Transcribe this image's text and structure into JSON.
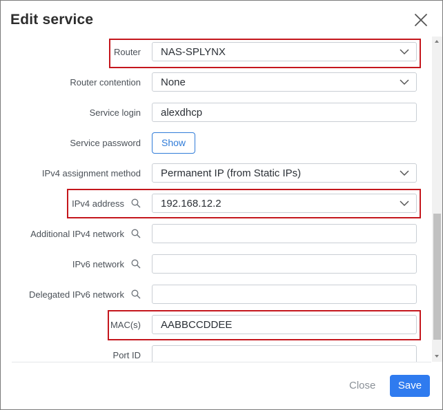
{
  "dialog": {
    "title": "Edit service"
  },
  "fields": {
    "router": {
      "label": "Router",
      "value": "NAS-SPLYNX"
    },
    "router_contention": {
      "label": "Router contention",
      "value": "None"
    },
    "service_login": {
      "label": "Service login",
      "value": "alexdhcp"
    },
    "service_password": {
      "label": "Service password",
      "button": "Show"
    },
    "ipv4_method": {
      "label": "IPv4 assignment method",
      "value": "Permanent IP (from Static IPs)"
    },
    "ipv4_address": {
      "label": "IPv4 address",
      "value": "192.168.12.2"
    },
    "additional_ipv4": {
      "label": "Additional IPv4 network",
      "value": ""
    },
    "ipv6_network": {
      "label": "IPv6 network",
      "value": ""
    },
    "delegated_ipv6": {
      "label": "Delegated IPv6 network",
      "value": ""
    },
    "macs": {
      "label": "MAC(s)",
      "value": "AABBCCDDEE"
    },
    "port_id": {
      "label": "Port ID",
      "value": ""
    }
  },
  "footer": {
    "close_label": "Close",
    "save_label": "Save"
  },
  "colors": {
    "primary": "#2f7bef",
    "highlight": "#c4161c"
  }
}
